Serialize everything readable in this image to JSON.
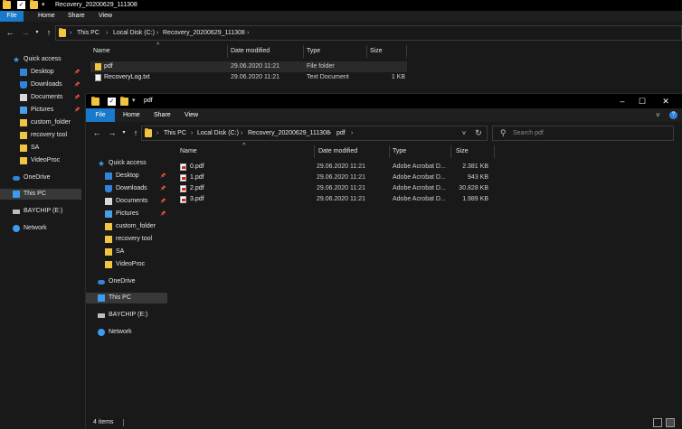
{
  "back": {
    "title": "Recovery_20200629_111308",
    "tabs": [
      "File",
      "Home",
      "Share",
      "View"
    ],
    "breadcrumb": [
      "This PC",
      "Local Disk (C:)",
      "Recovery_20200629_111308"
    ],
    "columns": [
      "Name",
      "Date modified",
      "Type",
      "Size"
    ],
    "nav": [
      {
        "label": "Quick access",
        "icon": "star-icon"
      },
      {
        "label": "Desktop",
        "icon": "desktop-icon",
        "pinned": true
      },
      {
        "label": "Downloads",
        "icon": "downloads-icon",
        "pinned": true
      },
      {
        "label": "Documents",
        "icon": "documents-icon",
        "pinned": true
      },
      {
        "label": "Pictures",
        "icon": "pictures-icon",
        "pinned": true
      },
      {
        "label": "custom_folder",
        "icon": "folder-icon"
      },
      {
        "label": "recovery tool",
        "icon": "folder-icon"
      },
      {
        "label": "SA",
        "icon": "folder-icon"
      },
      {
        "label": "VideoProc",
        "icon": "folder-icon"
      },
      {
        "label": "OneDrive",
        "icon": "cloud-icon"
      },
      {
        "label": "This PC",
        "icon": "computer-icon"
      },
      {
        "label": "BAYCHIP (E:)",
        "icon": "drive-icon"
      },
      {
        "label": "Network",
        "icon": "network-icon"
      }
    ],
    "files": [
      {
        "name": "pdf",
        "date": "29.06.2020 11:21",
        "type": "File folder",
        "size": "",
        "icon": "folder-icon"
      },
      {
        "name": "RecoveryLog.txt",
        "date": "29.06.2020 11:21",
        "type": "Text Document",
        "size": "1 KB",
        "icon": "text-file-icon"
      }
    ]
  },
  "front": {
    "title": "pdf",
    "tabs": [
      "File",
      "Home",
      "Share",
      "View"
    ],
    "breadcrumb": [
      "This PC",
      "Local Disk (C:)",
      "Recovery_20200629_111308",
      "pdf"
    ],
    "search_placeholder": "Search pdf",
    "columns": [
      "Name",
      "Date modified",
      "Type",
      "Size"
    ],
    "nav": [
      {
        "label": "Quick access",
        "icon": "star-icon"
      },
      {
        "label": "Desktop",
        "icon": "desktop-icon",
        "pinned": true
      },
      {
        "label": "Downloads",
        "icon": "downloads-icon",
        "pinned": true
      },
      {
        "label": "Documents",
        "icon": "documents-icon",
        "pinned": true
      },
      {
        "label": "Pictures",
        "icon": "pictures-icon",
        "pinned": true
      },
      {
        "label": "custom_folder",
        "icon": "folder-icon"
      },
      {
        "label": "recovery tool",
        "icon": "folder-icon"
      },
      {
        "label": "SA",
        "icon": "folder-icon"
      },
      {
        "label": "VideoProc",
        "icon": "folder-icon"
      },
      {
        "label": "OneDrive",
        "icon": "cloud-icon"
      },
      {
        "label": "This PC",
        "icon": "computer-icon"
      },
      {
        "label": "BAYCHIP (E:)",
        "icon": "drive-icon"
      },
      {
        "label": "Network",
        "icon": "network-icon"
      }
    ],
    "files": [
      {
        "name": "0.pdf",
        "date": "29.06.2020 11:21",
        "type": "Adobe Acrobat D...",
        "size": "2.381 KB",
        "icon": "pdf-file-icon"
      },
      {
        "name": "1.pdf",
        "date": "29.06.2020 11:21",
        "type": "Adobe Acrobat D...",
        "size": "943 KB",
        "icon": "pdf-file-icon"
      },
      {
        "name": "2.pdf",
        "date": "29.06.2020 11:21",
        "type": "Adobe Acrobat D...",
        "size": "30.828 KB",
        "icon": "pdf-file-icon"
      },
      {
        "name": "3.pdf",
        "date": "29.06.2020 11:21",
        "type": "Adobe Acrobat D...",
        "size": "1.989 KB",
        "icon": "pdf-file-icon"
      }
    ],
    "status": "4 items"
  },
  "colors": {
    "accent": "#1979ca",
    "background": "#191919",
    "folder": "#f1c542",
    "pdf": "#d3241c"
  }
}
